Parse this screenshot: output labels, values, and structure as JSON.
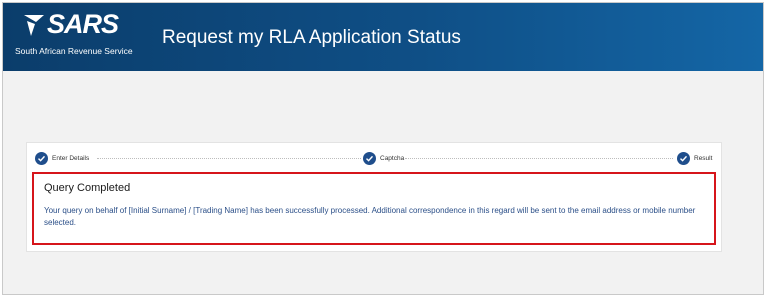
{
  "header": {
    "logo_text": "SARS",
    "org_name": "South African Revenue Service",
    "title": "Request my RLA Application Status"
  },
  "steps": [
    {
      "label": "Enter Details",
      "status": "completed"
    },
    {
      "label": "Captcha",
      "status": "completed"
    },
    {
      "label": "Result",
      "status": "completed"
    }
  ],
  "result": {
    "title": "Query Completed",
    "message": "Your query on behalf of [Initial Surname] / [Trading Name] has been successfully processed.  Additional correspondence in this regard will be sent to the email address or mobile number selected."
  },
  "colors": {
    "header_dark": "#0b3d6b",
    "header_light": "#1466a6",
    "step_check": "#1f4e8c",
    "result_border": "#d6151b",
    "message_text": "#2b4f88"
  }
}
